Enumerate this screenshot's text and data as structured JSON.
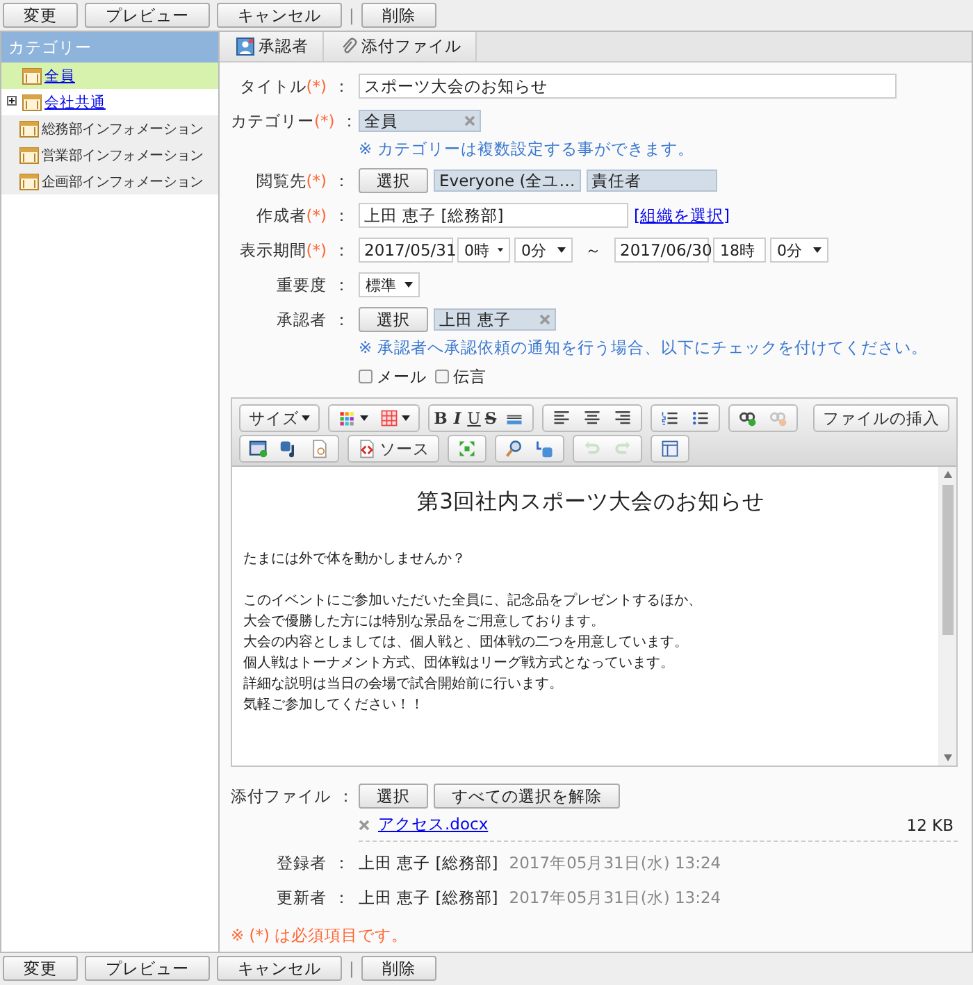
{
  "top_toolbar": [
    {
      "kind": "button",
      "label": "変更"
    },
    {
      "kind": "button",
      "label": "プレビュー"
    },
    {
      "kind": "button",
      "label": "キャンセル"
    },
    {
      "kind": "separator",
      "label": "|"
    },
    {
      "kind": "button",
      "label": "削除"
    }
  ],
  "sidebar": {
    "header": "カテゴリー",
    "items": [
      {
        "label": "全員",
        "selected": true,
        "link": true
      },
      {
        "label": "会社共通",
        "selected": false,
        "link": true,
        "expanded": false
      },
      {
        "label": "総務部インフォメーション",
        "selected": false,
        "link": false
      },
      {
        "label": "営業部インフォメーション",
        "selected": false,
        "link": false
      },
      {
        "label": "企画部インフォメーション",
        "selected": false,
        "link": false
      }
    ]
  },
  "tabs": [
    {
      "label": "承認者"
    },
    {
      "label": "添付ファイル"
    }
  ],
  "form": {
    "rows": [
      {
        "kind": "text",
        "label": "タイトル",
        "mark": "(*)",
        "sep": "：",
        "value": "スポーツ大会のお知らせ"
      },
      {
        "kind": "picker",
        "label": "カテゴリー",
        "mark": "(*)",
        "sep": "：",
        "chips": [
          {
            "label": "全員",
            "removable": true
          }
        ],
        "note": "※ カテゴリーは複数設定する事ができます。"
      },
      {
        "kind": "picker",
        "label": "閲覧先",
        "mark": "(*)",
        "sep": "：",
        "button": "選択",
        "chips": [
          {
            "label": "Everyone (全ユ…",
            "removable": false
          },
          {
            "label": "責任者",
            "removable": false
          }
        ]
      },
      {
        "kind": "text-link",
        "label": "作成者",
        "mark": "(*)",
        "sep": "：",
        "value": "上田 恵子 [総務部]",
        "link": "[組織を選択]"
      },
      {
        "kind": "period",
        "label": "表示期間",
        "mark": "(*)",
        "sep": "：",
        "start": {
          "date": "2017/05/31",
          "hour": "0時",
          "minute": "0分"
        },
        "tilde": "～",
        "end": {
          "date": "2017/06/30",
          "hour": "18時",
          "minute": "0分"
        }
      },
      {
        "kind": "select",
        "label": "重要度",
        "sep": "：",
        "value": "標準"
      },
      {
        "kind": "picker",
        "label": "承認者",
        "sep": "：",
        "button": "選択",
        "chips": [
          {
            "label": "上田 恵子",
            "removable": true
          }
        ],
        "note": "※ 承認者へ承認依頼の通知を行う場合、以下にチェックを付けてください。",
        "checkboxes": [
          {
            "label": "メール",
            "checked": false
          },
          {
            "label": "伝言",
            "checked": false
          }
        ]
      }
    ]
  },
  "editor": {
    "toolbar": [
      [
        [
          {
            "kind": "select",
            "label": "サイズ",
            "disabled": false
          }
        ],
        [
          {
            "kind": "icon-dropdown",
            "disabled": false
          },
          {
            "kind": "icon-dropdown",
            "disabled": false
          }
        ],
        [
          {
            "kind": "bold",
            "label": "B",
            "disabled": false
          },
          {
            "kind": "italic",
            "label": "I",
            "disabled": false
          },
          {
            "kind": "underline",
            "label": "U",
            "disabled": false
          },
          {
            "kind": "strike",
            "label": "S",
            "disabled": false
          },
          {
            "kind": "icon",
            "disabled": false
          }
        ],
        [
          {
            "kind": "icon",
            "disabled": false
          },
          {
            "kind": "icon",
            "disabled": false
          },
          {
            "kind": "icon",
            "disabled": false
          }
        ],
        [
          {
            "kind": "icon",
            "disabled": false
          },
          {
            "kind": "icon",
            "disabled": false
          }
        ],
        [
          {
            "kind": "icon",
            "disabled": false
          },
          {
            "kind": "icon",
            "disabled": true
          }
        ],
        [
          {
            "kind": "text",
            "label": "ファイルの挿入",
            "disabled": false
          }
        ]
      ],
      [
        [
          {
            "kind": "icon",
            "disabled": false
          },
          {
            "kind": "icon",
            "disabled": false
          },
          {
            "kind": "icon",
            "disabled": false
          }
        ],
        [
          {
            "kind": "icon-text",
            "label": "ソース",
            "disabled": false
          }
        ],
        [
          {
            "kind": "icon",
            "disabled": false
          }
        ],
        [
          {
            "kind": "icon",
            "disabled": false
          },
          {
            "kind": "icon",
            "disabled": false
          }
        ],
        [
          {
            "kind": "icon",
            "disabled": true
          },
          {
            "kind": "icon",
            "disabled": true
          }
        ],
        [
          {
            "kind": "icon",
            "disabled": false
          }
        ]
      ]
    ],
    "heading": "第3回社内スポーツ大会のお知らせ",
    "paragraphs": [
      [
        "たまには外で体を動かしませんか？"
      ],
      [
        "このイベントにご参加いただいた全員に、記念品をプレゼントするほか、",
        "大会で優勝した方には特別な景品をご用意しております。",
        "大会の内容としましては、個人戦と、団体戦の二つを用意しています。",
        "個人戦はトーナメント方式、団体戦はリーグ戦方式となっています。",
        "詳細な説明は当日の会場で試合開始前に行います。",
        "気軽ご参加してください！！"
      ]
    ]
  },
  "attachments": {
    "label": "添付ファイル",
    "sep": "：",
    "buttons": [
      "選択",
      "すべての選択を解除"
    ],
    "files": [
      {
        "name": "アクセス.docx",
        "size": "12 KB"
      }
    ]
  },
  "meta": [
    {
      "label": "登録者",
      "sep": "：",
      "name": "上田 恵子 [総務部]",
      "date": "2017年05月31日(水) 13:24"
    },
    {
      "label": "更新者",
      "sep": "：",
      "name": "上田 恵子 [総務部]",
      "date": "2017年05月31日(水) 13:24"
    }
  ],
  "footnote": "※ (*) は必須項目です。",
  "bottom_toolbar": [
    {
      "kind": "button",
      "label": "変更"
    },
    {
      "kind": "button",
      "label": "プレビュー"
    },
    {
      "kind": "button",
      "label": "キャンセル"
    },
    {
      "kind": "separator",
      "label": "|"
    },
    {
      "kind": "button",
      "label": "削除"
    }
  ]
}
